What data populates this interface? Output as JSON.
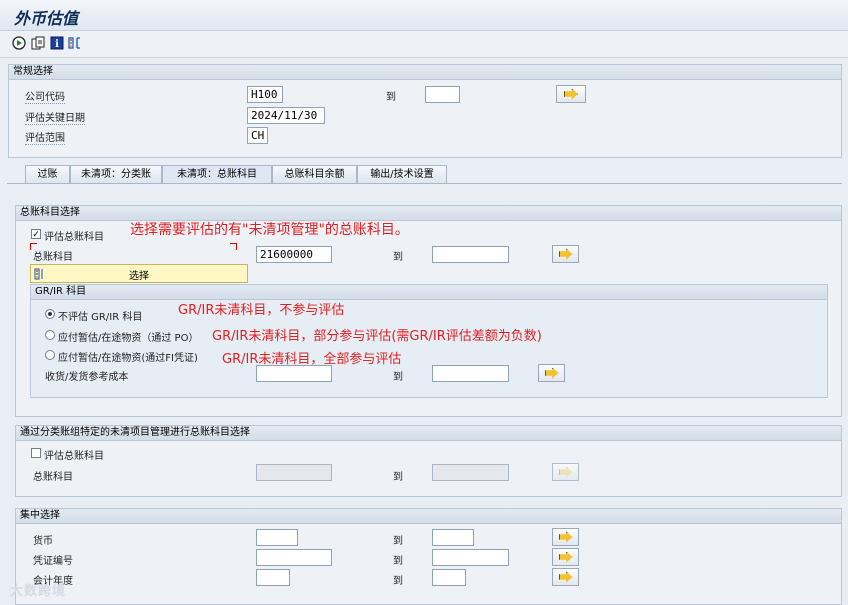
{
  "window": {
    "title": "外币估值"
  },
  "toolbar": {
    "icons": [
      "execute-icon",
      "copy-icon",
      "info-icon",
      "selection-icon"
    ]
  },
  "general": {
    "header": "常规选择",
    "company_code_label": "公司代码",
    "company_code_value": "H100",
    "to_label": "到",
    "key_date_label": "评估关键日期",
    "key_date_value": "2024/11/30",
    "area_label": "评估范围",
    "area_value": "CH"
  },
  "tabs": [
    "过账",
    "未清项：分类账",
    "未清项：总账科目",
    "总账科目余额",
    "输出/技术设置"
  ],
  "active_tab_index": 2,
  "gl_section": {
    "header": "总账科目选择",
    "checkbox_label": "评估总账科目",
    "checkbox_checked": true,
    "account_label": "总账科目",
    "account_value": "21600000",
    "to_label": "到",
    "popup_label": "选择",
    "annotation_top": "选择需要评估的有\"未清项管理\"的总账科目。",
    "grir": {
      "header": "GR/IR 科目",
      "options": [
        {
          "label": "不评估 GR/IR 科目",
          "selected": true,
          "annotation": "GR/IR未清科目，不参与评估"
        },
        {
          "label": "应付暂估/在途物资（通过 PO）",
          "selected": false,
          "annotation": "GR/IR未清科目，部分参与评估(需GR/IR评估差额为负数)"
        },
        {
          "label": "应付暂估/在途物资(通过FI凭证)",
          "selected": false,
          "annotation": "GR/IR未清科目，全部参与评估"
        }
      ],
      "cost_label": "收货/发货参考成本",
      "to_label": "到"
    }
  },
  "ledger_section": {
    "header": "通过分类账组特定的未清项目管理进行总账科目选择",
    "checkbox_label": "评估总账科目",
    "checkbox_checked": false,
    "account_label": "总账科目",
    "to_label": "到"
  },
  "central": {
    "header": "集中选择",
    "rows": [
      {
        "label": "货币",
        "to": "到"
      },
      {
        "label": "凭证编号",
        "to": "到"
      },
      {
        "label": "会计年度",
        "to": "到"
      }
    ]
  },
  "watermark": "大数跨境"
}
